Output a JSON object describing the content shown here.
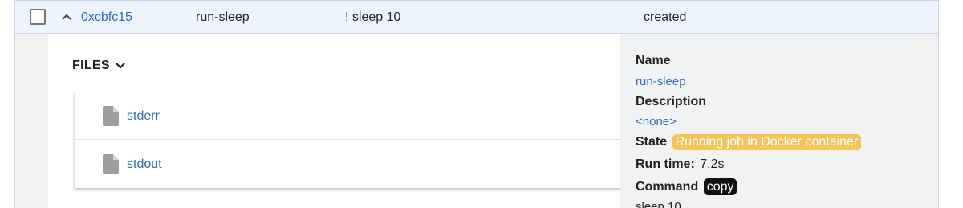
{
  "job_row": {
    "id": "0xcbfc15",
    "name": "run-sleep",
    "command": "! sleep 10",
    "status": "created"
  },
  "files": {
    "header": "FILES",
    "items": [
      {
        "name": "stderr"
      },
      {
        "name": "stdout"
      }
    ]
  },
  "details": {
    "name_label": "Name",
    "name_value": "run-sleep",
    "description_label": "Description",
    "description_value": "<none>",
    "state_label": "State",
    "state_value": "Running job in Docker container",
    "runtime_label": "Run time:",
    "runtime_value": "7.2s",
    "command_label": "Command",
    "copy_label": "copy",
    "command_value": "sleep 10"
  },
  "icons": {
    "expand": "chevron-up-icon",
    "files_toggle": "chevron-down-icon",
    "file": "file-icon"
  },
  "colors": {
    "link": "#2f6fb3",
    "row_selected_bg": "#eef4fb",
    "state_badge": "#f6c35b",
    "copy_button": "#111111",
    "details_bg": "#f1f2f3"
  }
}
